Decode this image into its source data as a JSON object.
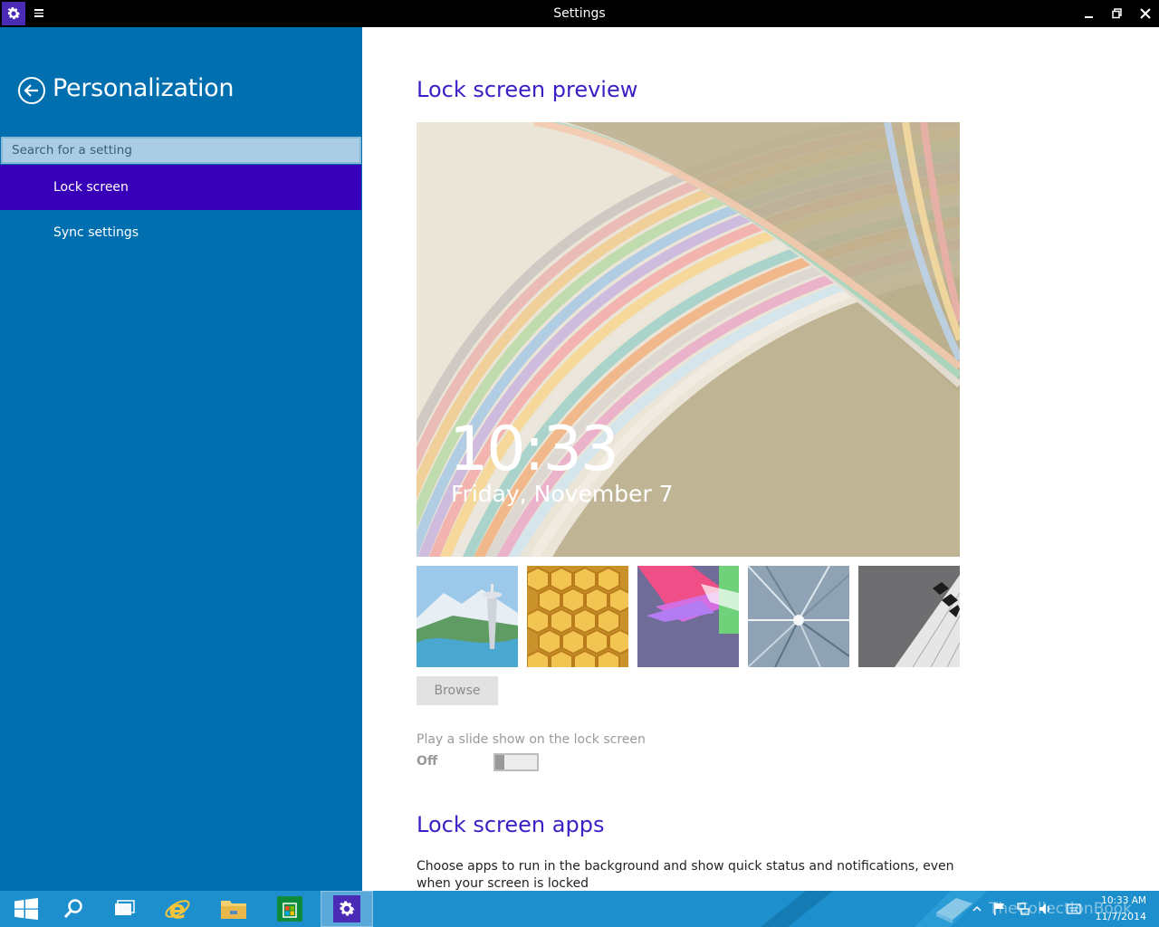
{
  "window": {
    "title": "Settings"
  },
  "sidebar": {
    "title": "Personalization",
    "search_placeholder": "Search for a setting",
    "items": [
      {
        "label": "Lock screen",
        "active": true
      },
      {
        "label": "Sync settings",
        "active": false
      }
    ]
  },
  "main": {
    "preview_heading": "Lock screen preview",
    "preview_time": "10:33",
    "preview_date": "Friday, November 7",
    "thumbnails": [
      "space-needle-landscape",
      "honeycomb",
      "colorful-shapes",
      "motion-tunnel",
      "piano-keys"
    ],
    "browse_label": "Browse",
    "slideshow_label": "Play a slide show on the lock screen",
    "slideshow_state": "Off",
    "apps_heading": "Lock screen apps",
    "apps_description": "Choose apps to run in the background and show quick status and notifications, even when your screen is locked"
  },
  "taskbar": {
    "clock_time": "10:33 AM",
    "clock_date": "11/7/2014",
    "watermark": "TheCollectionBook"
  },
  "colors": {
    "sidebar_bg": "#006fb0",
    "active_item": "#3700b8",
    "heading": "#3d1ec4",
    "taskbar": "#1d8fcc",
    "titlebar": "#000000"
  }
}
